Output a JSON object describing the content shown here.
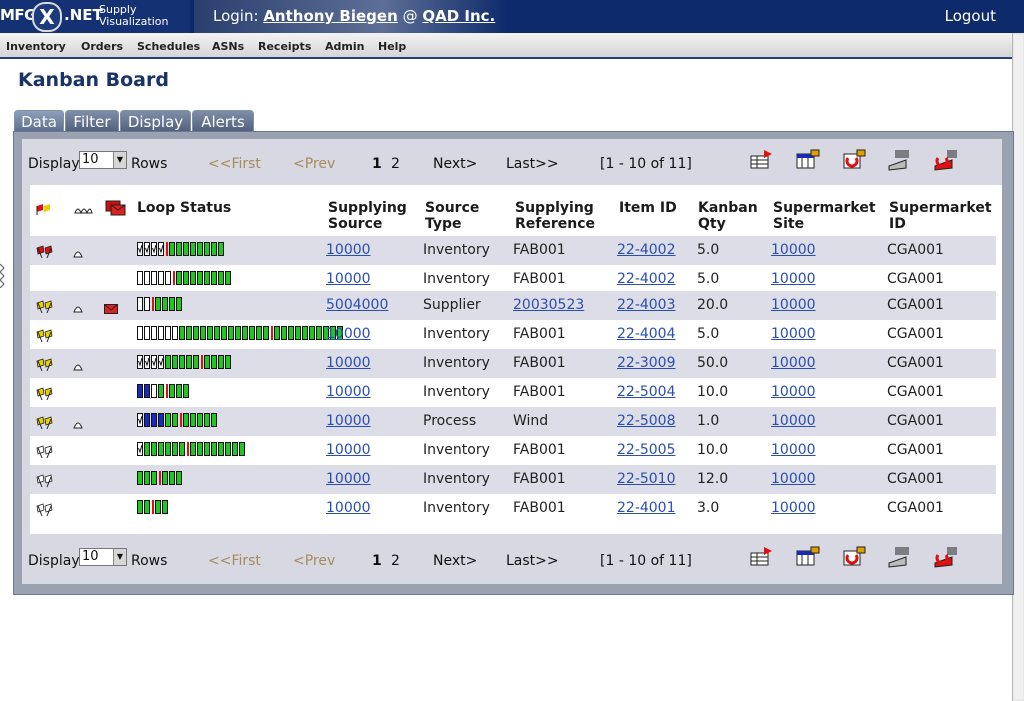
{
  "header": {
    "logo_left": "MFG",
    "logo_x": "X",
    "logo_net": ".NET",
    "logo_sub1": "Supply",
    "logo_sub2": "Visualization",
    "login_prefix": "Login:",
    "user": "Anthony Biegen",
    "at": "@",
    "company": "QAD Inc.",
    "logout": "Logout"
  },
  "nav": [
    "Inventory",
    "Orders",
    "Schedules",
    "ASNs",
    "Receipts",
    "Admin",
    "Help"
  ],
  "page_title": "Kanban Board",
  "tabs": [
    "Data",
    "Filter",
    "Display",
    "Alerts"
  ],
  "pager": {
    "display_label": "Display",
    "rows_value": "10",
    "rows_label": "Rows",
    "first": "<<First",
    "prev": "<Prev",
    "page1": "1",
    "page2": "2",
    "next": "Next>",
    "last": "Last>>",
    "range": "[1 - 10  of  11]"
  },
  "columns": {
    "loop_status": "Loop Status",
    "supplying_source_1": "Supplying",
    "supplying_source_2": "Source",
    "source_type_1": "Source",
    "source_type_2": "Type",
    "supplying_ref_1": "Supplying",
    "supplying_ref_2": "Reference",
    "item_id": "Item ID",
    "kanban_qty_1": "Kanban",
    "kanban_qty_2": "Qty",
    "sm_site_1": "Supermarket",
    "sm_site_2": "Site",
    "sm_id_1": "Supermarket",
    "sm_id_2": "ID"
  },
  "rows": [
    {
      "flag": "red",
      "bell": true,
      "mail": false,
      "loop": "c4,r1,g8",
      "source": "10000",
      "type": "Inventory",
      "ref": "FAB001",
      "ref_link": false,
      "item": "22-4002",
      "qty": "5.0",
      "site": "10000",
      "sm_id": "CGA001"
    },
    {
      "flag": "none",
      "bell": false,
      "mail": false,
      "loop": "e5,r1,g8",
      "source": "10000",
      "type": "Inventory",
      "ref": "FAB001",
      "ref_link": false,
      "item": "22-4002",
      "qty": "5.0",
      "site": "10000",
      "sm_id": "CGA001"
    },
    {
      "flag": "yellow",
      "bell": true,
      "mail": true,
      "loop": "e2,r1,g4",
      "source": "5004000",
      "type": "Supplier",
      "ref": "20030523",
      "ref_link": true,
      "item": "22-4003",
      "qty": "20.0",
      "site": "10000",
      "sm_id": "CGA001"
    },
    {
      "flag": "yellow",
      "bell": false,
      "mail": false,
      "loop": "e6,g13,r1,g10",
      "source": "10000",
      "type": "Inventory",
      "ref": "FAB001",
      "ref_link": false,
      "item": "22-4004",
      "qty": "5.0",
      "site": "10000",
      "sm_id": "CGA001"
    },
    {
      "flag": "yellow",
      "bell": true,
      "mail": false,
      "loop": "c4,g5,r1,g4",
      "source": "10000",
      "type": "Inventory",
      "ref": "FAB001",
      "ref_link": false,
      "item": "22-3009",
      "qty": "50.0",
      "site": "10000",
      "sm_id": "CGA001"
    },
    {
      "flag": "yellow",
      "bell": false,
      "mail": false,
      "loop": "b2,e1,g1,r1,g3",
      "source": "10000",
      "type": "Inventory",
      "ref": "FAB001",
      "ref_link": false,
      "item": "22-5004",
      "qty": "10.0",
      "site": "10000",
      "sm_id": "CGA001"
    },
    {
      "flag": "yellow",
      "bell": true,
      "mail": false,
      "loop": "c1,b3,g2,r1,g5",
      "source": "10000",
      "type": "Process",
      "ref": "Wind",
      "ref_link": false,
      "item": "22-5008",
      "qty": "1.0",
      "site": "10000",
      "sm_id": "CGA001"
    },
    {
      "flag": "white",
      "bell": false,
      "mail": false,
      "loop": "c1,g6,r1,g8",
      "source": "10000",
      "type": "Inventory",
      "ref": "FAB001",
      "ref_link": false,
      "item": "22-5005",
      "qty": "10.0",
      "site": "10000",
      "sm_id": "CGA001"
    },
    {
      "flag": "white",
      "bell": false,
      "mail": false,
      "loop": "g3,r1,g3",
      "source": "10000",
      "type": "Inventory",
      "ref": "FAB001",
      "ref_link": false,
      "item": "22-5010",
      "qty": "12.0",
      "site": "10000",
      "sm_id": "CGA001"
    },
    {
      "flag": "white",
      "bell": false,
      "mail": false,
      "loop": "g2,r1,g2",
      "source": "10000",
      "type": "Inventory",
      "ref": "FAB001",
      "ref_link": false,
      "item": "22-4001",
      "qty": "3.0",
      "site": "10000",
      "sm_id": "CGA001"
    }
  ],
  "colors": {
    "green": "#1ec81e",
    "red": "#e01010",
    "blue": "#1a2ab8",
    "link": "#2a4fb0",
    "header_bg": "#0d2a6a"
  }
}
